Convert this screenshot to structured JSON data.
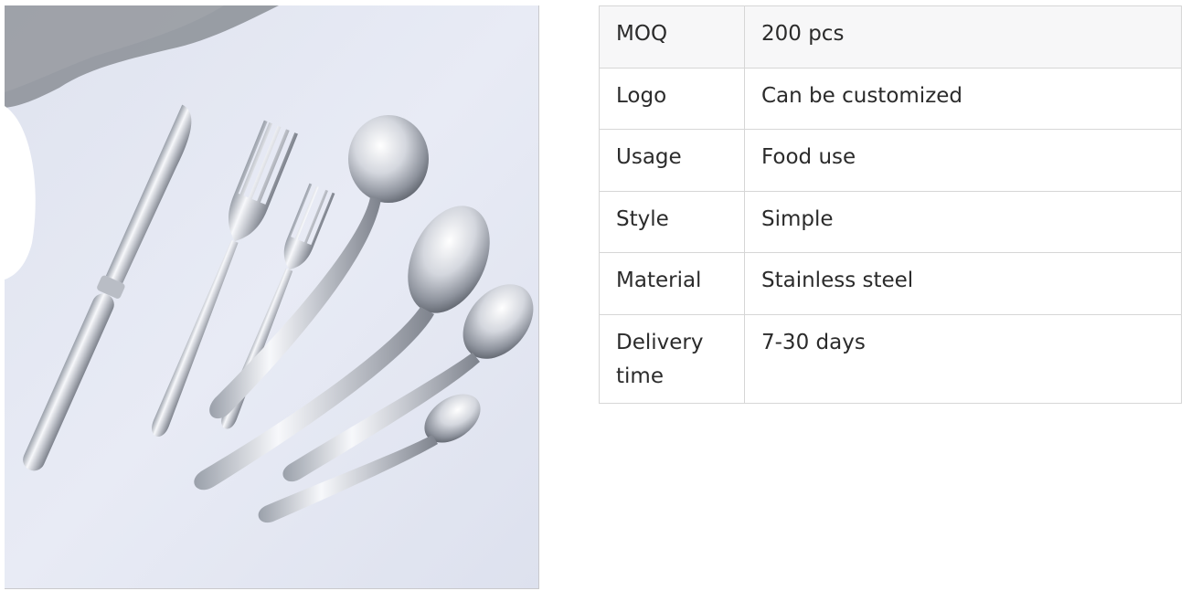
{
  "product_image": {
    "icon": "cutlery-set-photo",
    "background_color": "#e4e8f3"
  },
  "specs": [
    {
      "key": "MOQ",
      "value": "200 pcs"
    },
    {
      "key": "Logo",
      "value": "Can be customized"
    },
    {
      "key": "Usage",
      "value": "Food use"
    },
    {
      "key": "Style",
      "value": "Simple"
    },
    {
      "key": "Material",
      "value": "Stainless steel"
    },
    {
      "key": "Delivery time",
      "value": "7-30 days"
    }
  ]
}
